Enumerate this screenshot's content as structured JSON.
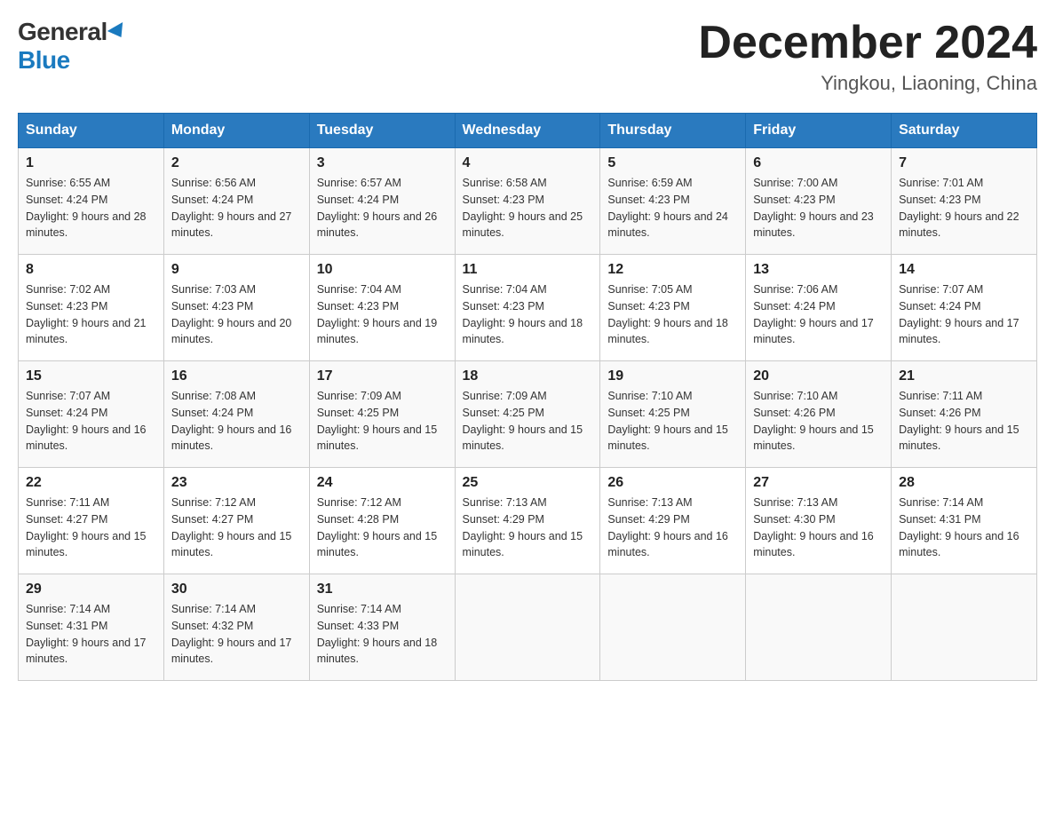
{
  "header": {
    "logo_general": "General",
    "logo_blue": "Blue",
    "month_title": "December 2024",
    "location": "Yingkou, Liaoning, China"
  },
  "weekdays": [
    "Sunday",
    "Monday",
    "Tuesday",
    "Wednesday",
    "Thursday",
    "Friday",
    "Saturday"
  ],
  "weeks": [
    [
      {
        "day": "1",
        "sunrise": "6:55 AM",
        "sunset": "4:24 PM",
        "daylight": "9 hours and 28 minutes."
      },
      {
        "day": "2",
        "sunrise": "6:56 AM",
        "sunset": "4:24 PM",
        "daylight": "9 hours and 27 minutes."
      },
      {
        "day": "3",
        "sunrise": "6:57 AM",
        "sunset": "4:24 PM",
        "daylight": "9 hours and 26 minutes."
      },
      {
        "day": "4",
        "sunrise": "6:58 AM",
        "sunset": "4:23 PM",
        "daylight": "9 hours and 25 minutes."
      },
      {
        "day": "5",
        "sunrise": "6:59 AM",
        "sunset": "4:23 PM",
        "daylight": "9 hours and 24 minutes."
      },
      {
        "day": "6",
        "sunrise": "7:00 AM",
        "sunset": "4:23 PM",
        "daylight": "9 hours and 23 minutes."
      },
      {
        "day": "7",
        "sunrise": "7:01 AM",
        "sunset": "4:23 PM",
        "daylight": "9 hours and 22 minutes."
      }
    ],
    [
      {
        "day": "8",
        "sunrise": "7:02 AM",
        "sunset": "4:23 PM",
        "daylight": "9 hours and 21 minutes."
      },
      {
        "day": "9",
        "sunrise": "7:03 AM",
        "sunset": "4:23 PM",
        "daylight": "9 hours and 20 minutes."
      },
      {
        "day": "10",
        "sunrise": "7:04 AM",
        "sunset": "4:23 PM",
        "daylight": "9 hours and 19 minutes."
      },
      {
        "day": "11",
        "sunrise": "7:04 AM",
        "sunset": "4:23 PM",
        "daylight": "9 hours and 18 minutes."
      },
      {
        "day": "12",
        "sunrise": "7:05 AM",
        "sunset": "4:23 PM",
        "daylight": "9 hours and 18 minutes."
      },
      {
        "day": "13",
        "sunrise": "7:06 AM",
        "sunset": "4:24 PM",
        "daylight": "9 hours and 17 minutes."
      },
      {
        "day": "14",
        "sunrise": "7:07 AM",
        "sunset": "4:24 PM",
        "daylight": "9 hours and 17 minutes."
      }
    ],
    [
      {
        "day": "15",
        "sunrise": "7:07 AM",
        "sunset": "4:24 PM",
        "daylight": "9 hours and 16 minutes."
      },
      {
        "day": "16",
        "sunrise": "7:08 AM",
        "sunset": "4:24 PM",
        "daylight": "9 hours and 16 minutes."
      },
      {
        "day": "17",
        "sunrise": "7:09 AM",
        "sunset": "4:25 PM",
        "daylight": "9 hours and 15 minutes."
      },
      {
        "day": "18",
        "sunrise": "7:09 AM",
        "sunset": "4:25 PM",
        "daylight": "9 hours and 15 minutes."
      },
      {
        "day": "19",
        "sunrise": "7:10 AM",
        "sunset": "4:25 PM",
        "daylight": "9 hours and 15 minutes."
      },
      {
        "day": "20",
        "sunrise": "7:10 AM",
        "sunset": "4:26 PM",
        "daylight": "9 hours and 15 minutes."
      },
      {
        "day": "21",
        "sunrise": "7:11 AM",
        "sunset": "4:26 PM",
        "daylight": "9 hours and 15 minutes."
      }
    ],
    [
      {
        "day": "22",
        "sunrise": "7:11 AM",
        "sunset": "4:27 PM",
        "daylight": "9 hours and 15 minutes."
      },
      {
        "day": "23",
        "sunrise": "7:12 AM",
        "sunset": "4:27 PM",
        "daylight": "9 hours and 15 minutes."
      },
      {
        "day": "24",
        "sunrise": "7:12 AM",
        "sunset": "4:28 PM",
        "daylight": "9 hours and 15 minutes."
      },
      {
        "day": "25",
        "sunrise": "7:13 AM",
        "sunset": "4:29 PM",
        "daylight": "9 hours and 15 minutes."
      },
      {
        "day": "26",
        "sunrise": "7:13 AM",
        "sunset": "4:29 PM",
        "daylight": "9 hours and 16 minutes."
      },
      {
        "day": "27",
        "sunrise": "7:13 AM",
        "sunset": "4:30 PM",
        "daylight": "9 hours and 16 minutes."
      },
      {
        "day": "28",
        "sunrise": "7:14 AM",
        "sunset": "4:31 PM",
        "daylight": "9 hours and 16 minutes."
      }
    ],
    [
      {
        "day": "29",
        "sunrise": "7:14 AM",
        "sunset": "4:31 PM",
        "daylight": "9 hours and 17 minutes."
      },
      {
        "day": "30",
        "sunrise": "7:14 AM",
        "sunset": "4:32 PM",
        "daylight": "9 hours and 17 minutes."
      },
      {
        "day": "31",
        "sunrise": "7:14 AM",
        "sunset": "4:33 PM",
        "daylight": "9 hours and 18 minutes."
      },
      null,
      null,
      null,
      null
    ]
  ]
}
